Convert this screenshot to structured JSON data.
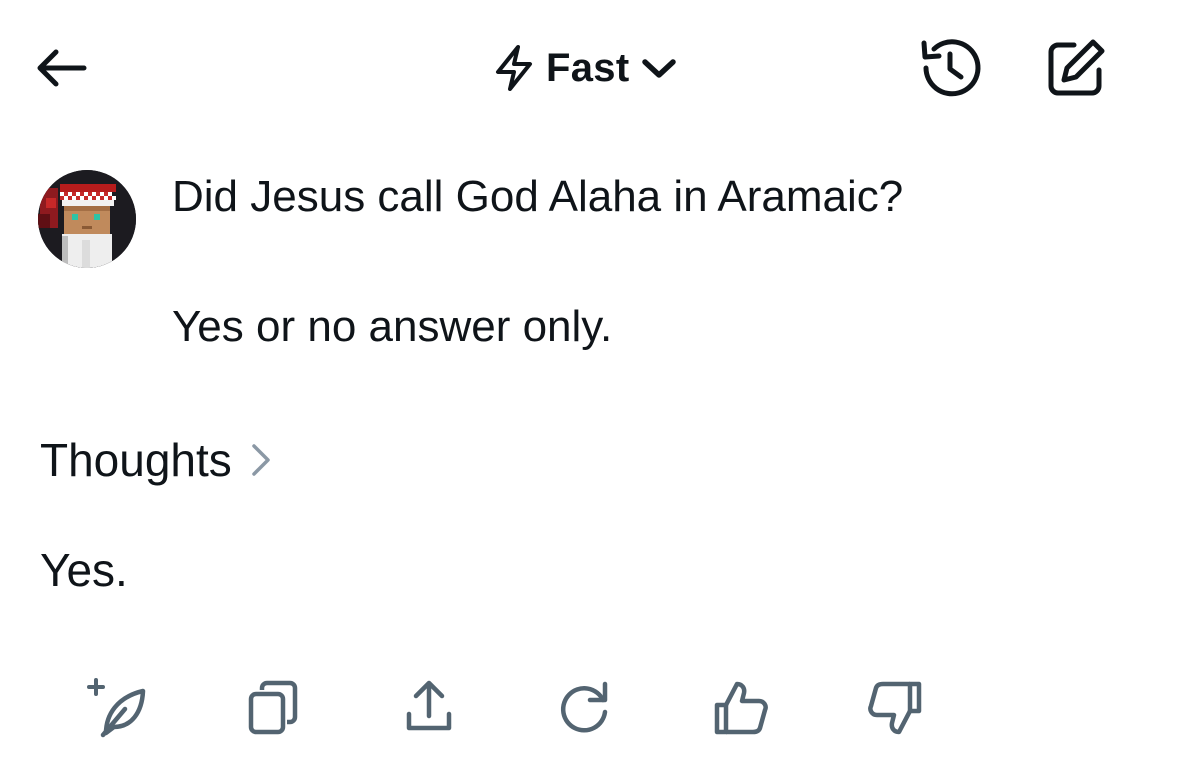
{
  "header": {
    "mode_label": "Fast",
    "icons": {
      "back": "arrow-left-icon",
      "mode": "lightning-bolt-icon",
      "dropdown": "chevron-down-icon",
      "history": "history-icon",
      "compose": "compose-icon"
    }
  },
  "conversation": {
    "user_message": {
      "avatar": "pixel-art-avatar",
      "lines": [
        "Did Jesus call God Alaha in Aramaic?",
        "Yes or no answer only."
      ]
    },
    "thoughts_label": "Thoughts",
    "answer": "Yes."
  },
  "actions": [
    {
      "name": "regenerate-with-feather",
      "icon": "feather-plus-icon"
    },
    {
      "name": "copy",
      "icon": "copy-icon"
    },
    {
      "name": "share",
      "icon": "share-icon"
    },
    {
      "name": "retry",
      "icon": "refresh-icon"
    },
    {
      "name": "like",
      "icon": "thumbs-up-icon"
    },
    {
      "name": "dislike",
      "icon": "thumbs-down-icon"
    }
  ],
  "colors": {
    "text": "#0f1419",
    "icon_gray": "#536471",
    "chevron_gray": "#8b98a5",
    "background": "#ffffff"
  }
}
